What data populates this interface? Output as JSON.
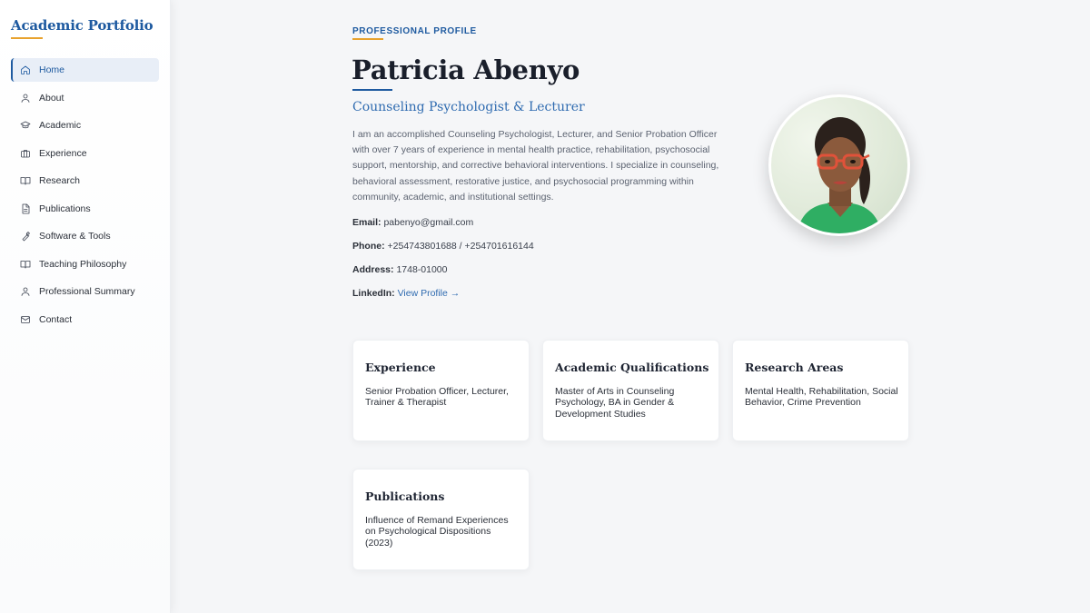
{
  "sidebar": {
    "brand": "Academic Portfolio",
    "items": [
      {
        "label": "Home",
        "icon": "home-icon",
        "active": true
      },
      {
        "label": "About",
        "icon": "user-icon",
        "active": false
      },
      {
        "label": "Academic",
        "icon": "graduation-cap-icon",
        "active": false
      },
      {
        "label": "Experience",
        "icon": "briefcase-icon",
        "active": false
      },
      {
        "label": "Research",
        "icon": "book-open-icon",
        "active": false
      },
      {
        "label": "Publications",
        "icon": "document-icon",
        "active": false
      },
      {
        "label": "Software & Tools",
        "icon": "wrench-icon",
        "active": false
      },
      {
        "label": "Teaching Philosophy",
        "icon": "book-icon",
        "active": false
      },
      {
        "label": "Professional Summary",
        "icon": "user-icon",
        "active": false
      },
      {
        "label": "Contact",
        "icon": "mail-icon",
        "active": false
      }
    ]
  },
  "profile": {
    "eyebrow": "PROFESSIONAL PROFILE",
    "name": "Patricia Abenyo",
    "role": "Counseling Psychologist & Lecturer",
    "bio": "I am an accomplished Counseling Psychologist, Lecturer, and Senior Probation Officer with over 7 years of experience in mental health practice, rehabilitation, psychosocial support, mentorship, and corrective behavioral interventions. I specialize in counseling, behavioral assessment, restorative justice, and psychosocial programming within community, academic, and institutional settings.",
    "contact": {
      "email_label": "Email:",
      "email": "pabenyo@gmail.com",
      "phone_label": "Phone:",
      "phone": "+254743801688 / +254701616144",
      "address_label": "Address:",
      "address": "1748-01000",
      "linkedin_label": "LinkedIn:",
      "linkedin": "View Profile →"
    }
  },
  "cards": [
    {
      "title": "Experience",
      "body": "Senior Probation Officer, Lecturer, Trainer & Therapist"
    },
    {
      "title": "Academic Qualifications",
      "body": "Master of Arts in Counseling Psychology, BA in Gender & Development Studies"
    },
    {
      "title": "Research Areas",
      "body": "Mental Health, Rehabilitation, Social Behavior, Crime Prevention"
    },
    {
      "title": "Publications",
      "body": "Influence of Remand Experiences on Psychological Dispositions (2023)"
    }
  ],
  "colors": {
    "accent": "#1e5aa0",
    "highlight": "#e8a22d",
    "background": "#f5f6f8"
  }
}
